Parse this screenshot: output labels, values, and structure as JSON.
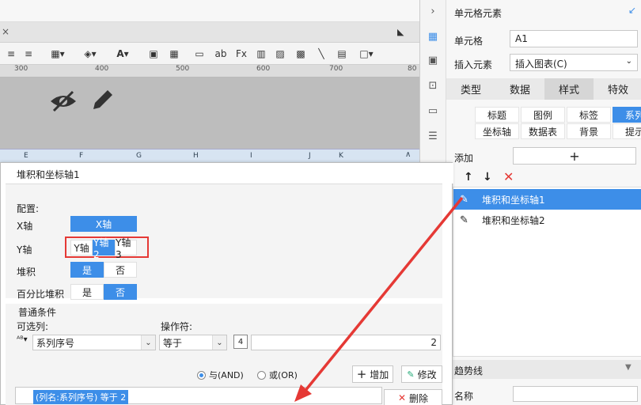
{
  "ruler": {
    "ticks": [
      "300",
      "400",
      "500",
      "600",
      "700",
      "80"
    ]
  },
  "columns": [
    "E",
    "F",
    "G",
    "H",
    "I",
    "J",
    "K"
  ],
  "dialog": {
    "title": "堆积和坐标轴1",
    "config": {
      "section": "配置:",
      "x_axis_label": "X轴",
      "x_axis_value": "X轴",
      "y_axis_label": "Y轴",
      "y_axis_options": [
        "Y轴",
        "Y轴2",
        "Y轴3"
      ],
      "y_axis_selected": 1,
      "stack_label": "堆积",
      "percent_stack_label": "百分比堆积",
      "yes": "是",
      "no": "否"
    },
    "condition": {
      "section": "普通条件",
      "columns_label": "可选列:",
      "operator_label": "操作符:",
      "column_value": "系列序号",
      "operator_value": "等于",
      "value": "2",
      "and_label": "与(AND)",
      "or_label": "或(OR)",
      "add_button": "增加",
      "modify_button": "修改",
      "delete_button": "删除",
      "condition_item": "(列名:系列序号) 等于 2"
    }
  },
  "panel": {
    "title": "单元格元素",
    "cell_label": "单元格",
    "cell_value": "A1",
    "insert_label": "插入元素",
    "insert_value": "插入图表(C)",
    "tabs": [
      "类型",
      "数据",
      "样式",
      "特效"
    ],
    "active_tab": "样式",
    "subtabs": [
      "标题",
      "图例",
      "标签",
      "系列",
      "坐标轴",
      "数据表",
      "背景",
      "提示"
    ],
    "active_subtab": "系列",
    "add_label": "添加",
    "series": [
      "堆积和坐标轴1",
      "堆积和坐标轴2"
    ],
    "trend_label": "趋势线",
    "name_label": "名称"
  },
  "colors": {
    "accent": "#3d8ee8",
    "arrow": "#e53935"
  }
}
